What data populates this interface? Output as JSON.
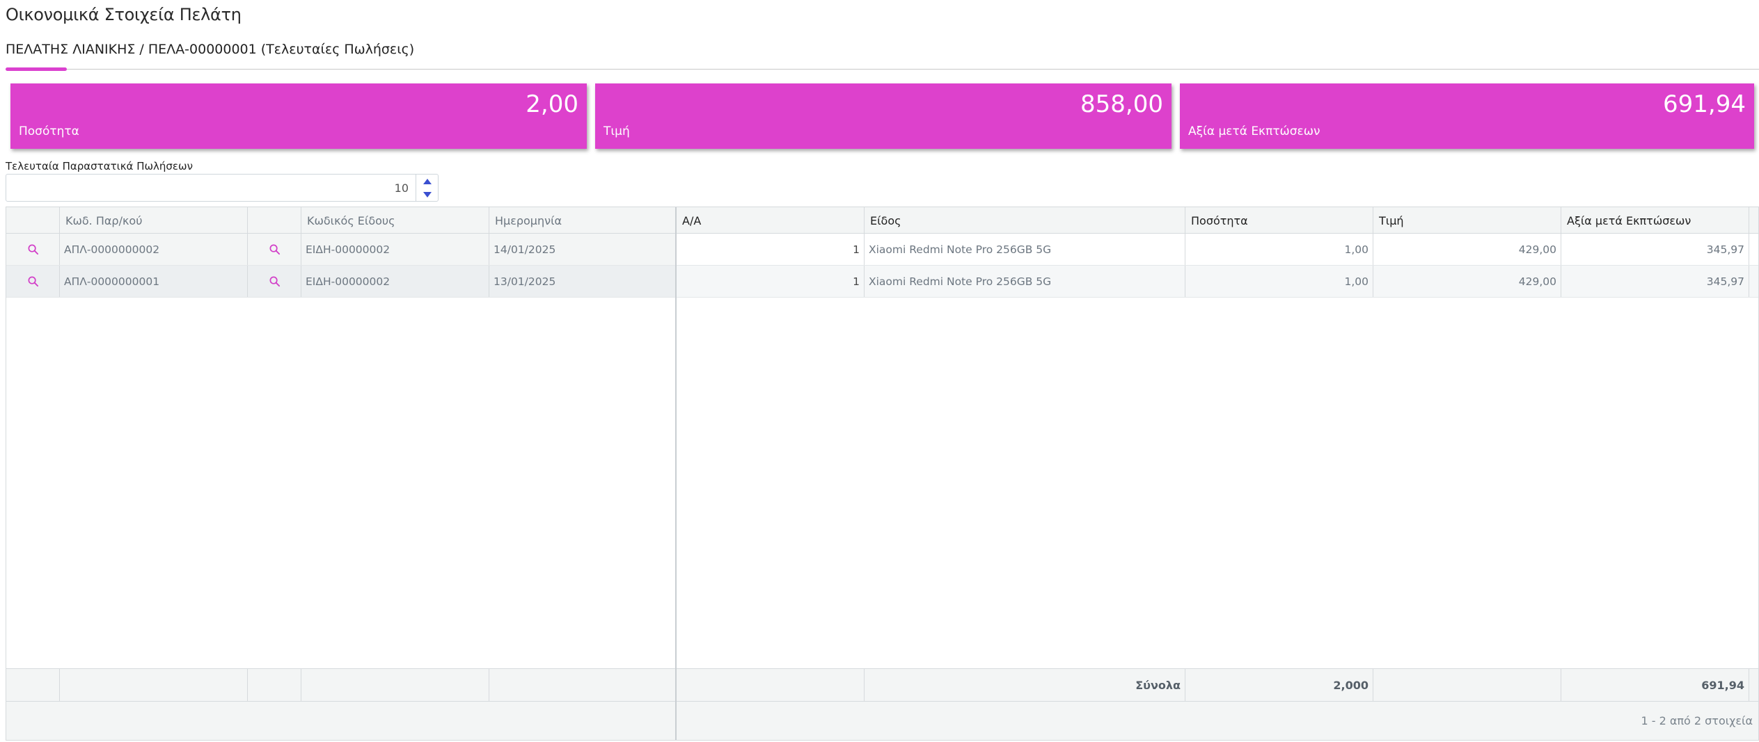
{
  "page": {
    "title": "Οικονομικά Στοιχεία Πελάτη",
    "breadcrumb": "ΠΕΛΑΤΗΣ ΛΙΑΝΙΚΗΣ / ΠΕΛΑ-00000001 (Τελευταίες Πωλήσεις)"
  },
  "accent_color": "#DD41CC",
  "stats": [
    {
      "value": "2,00",
      "label": "Ποσότητα"
    },
    {
      "value": "858,00",
      "label": "Τιμή"
    },
    {
      "value": "691,94",
      "label": "Αξία μετά Εκπτώσεων"
    }
  ],
  "last_docs": {
    "label": "Τελευταία Παραστατικά Πωλήσεων",
    "value": "10"
  },
  "grid": {
    "columns": {
      "doc_code": "Κωδ. Παρ/κού",
      "item_code": "Κωδικός Είδους",
      "date": "Ημερομηνία",
      "aa": "Α/Α",
      "item": "Είδος",
      "qty": "Ποσότητα",
      "price": "Τιμή",
      "net": "Αξία μετά Εκπτώσεων"
    },
    "rows": [
      {
        "doc_code": "ΑΠΛ-0000000002",
        "item_code": "ΕΙΔΗ-00000002",
        "date": "14/01/2025",
        "aa": "1",
        "item": "Xiaomi Redmi Note Pro 256GB 5G",
        "qty": "1,00",
        "price": "429,00",
        "net": "345,97"
      },
      {
        "doc_code": "ΑΠΛ-0000000001",
        "item_code": "ΕΙΔΗ-00000002",
        "date": "13/01/2025",
        "aa": "1",
        "item": "Xiaomi Redmi Note Pro 256GB 5G",
        "qty": "1,00",
        "price": "429,00",
        "net": "345,97"
      }
    ],
    "totals": {
      "label": "Σύνολα",
      "qty": "2,000",
      "net": "691,94"
    },
    "pager": "1 - 2 από 2 στοιχεία"
  }
}
